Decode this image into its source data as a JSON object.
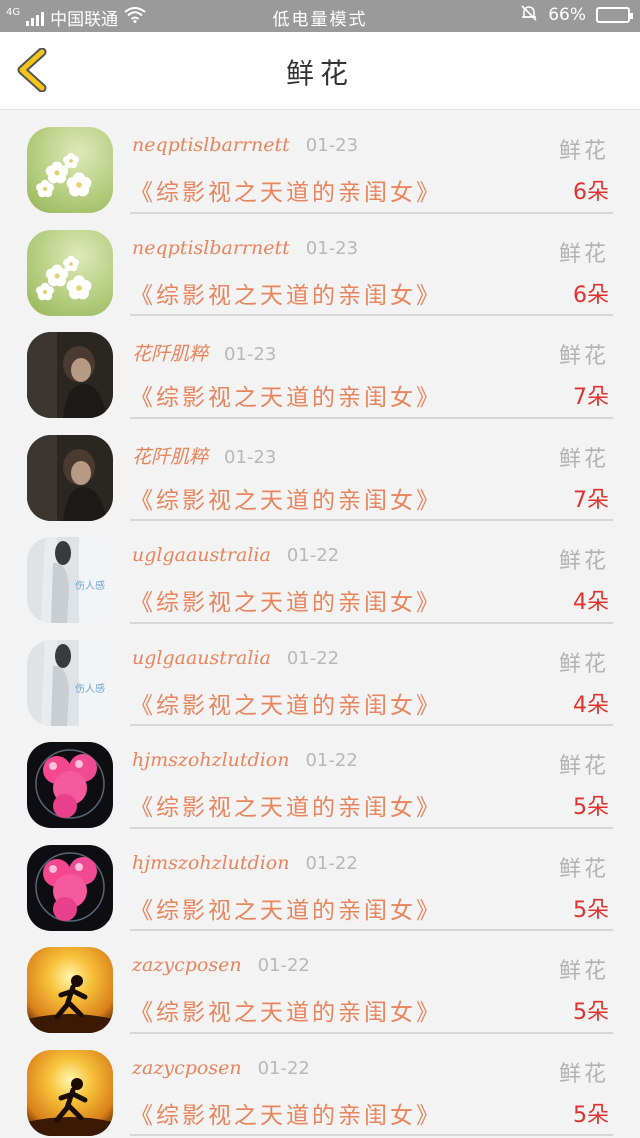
{
  "status_bar": {
    "network": "4G",
    "carrier": "中国联通",
    "mode": "低电量模式",
    "battery": "66%",
    "battery_level": 0.66
  },
  "header": {
    "title": "鲜花"
  },
  "icons": {
    "back": "chevron-left-icon",
    "wifi": "wifi-icon",
    "bell": "bell-mute-icon",
    "battery": "battery-icon"
  },
  "colors": {
    "username": "#e9855c",
    "count": "#e2322f",
    "back_icon": "#f5c518",
    "status_bar": "#9a9a9a",
    "battery_fill": "#3adf3a"
  },
  "items": [
    {
      "user": "neqptislbarrnett",
      "date": "01-23",
      "kind": "鲜花",
      "book": "《综影视之天道的亲闺女》",
      "count": "6朵",
      "avatar": "white-flower"
    },
    {
      "user": "neqptislbarrnett",
      "date": "01-23",
      "kind": "鲜花",
      "book": "《综影视之天道的亲闺女》",
      "count": "6朵",
      "avatar": "white-flower"
    },
    {
      "user": "花阡肌粹",
      "date": "01-23",
      "kind": "鲜花",
      "book": "《综影视之天道的亲闺女》",
      "count": "7朵",
      "avatar": "dark-portrait"
    },
    {
      "user": "花阡肌粹",
      "date": "01-23",
      "kind": "鲜花",
      "book": "《综影视之天道的亲闺女》",
      "count": "7朵",
      "avatar": "dark-portrait"
    },
    {
      "user": "uglgaaustralia",
      "date": "01-22",
      "kind": "鲜花",
      "book": "《综影视之天道的亲闺女》",
      "count": "4朵",
      "avatar": "grey-figure"
    },
    {
      "user": "uglgaaustralia",
      "date": "01-22",
      "kind": "鲜花",
      "book": "《综影视之天道的亲闺女》",
      "count": "4朵",
      "avatar": "grey-figure"
    },
    {
      "user": "hjmszohzlutdion",
      "date": "01-22",
      "kind": "鲜花",
      "book": "《综影视之天道的亲闺女》",
      "count": "5朵",
      "avatar": "pink-balloons"
    },
    {
      "user": "hjmszohzlutdion",
      "date": "01-22",
      "kind": "鲜花",
      "book": "《综影视之天道的亲闺女》",
      "count": "5朵",
      "avatar": "pink-balloons"
    },
    {
      "user": "zazycposen",
      "date": "01-22",
      "kind": "鲜花",
      "book": "《综影视之天道的亲闺女》",
      "count": "5朵",
      "avatar": "sunset-runner"
    },
    {
      "user": "zazycposen",
      "date": "01-22",
      "kind": "鲜花",
      "book": "《综影视之天道的亲闺女》",
      "count": "5朵",
      "avatar": "sunset-runner"
    }
  ]
}
